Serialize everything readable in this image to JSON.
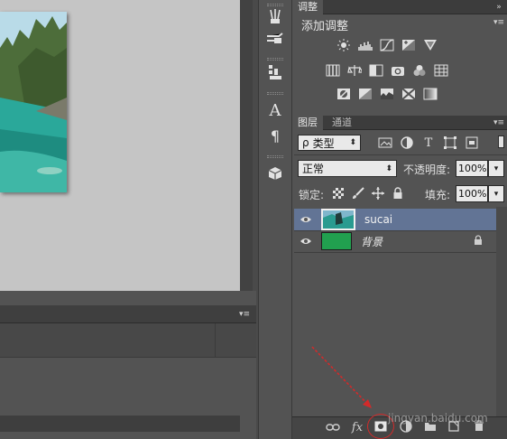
{
  "colors": {
    "panel": "#535353",
    "selected_layer": "#627495",
    "background_swatch": "#21a04f",
    "arrow": "#d22a2a"
  },
  "adjustments": {
    "tab_label": "调整",
    "title": "添加调整",
    "row1": [
      "brightness-icon",
      "levels-icon",
      "curves-icon",
      "exposure-icon",
      "vibrance-icon"
    ],
    "row2": [
      "hue-saturation-icon",
      "color-balance-icon",
      "black-white-icon",
      "photo-filter-icon",
      "channel-mixer-icon",
      "color-lookup-icon"
    ],
    "row3": [
      "invert-icon",
      "posterize-icon",
      "threshold-icon",
      "selective-color-icon",
      "gradient-map-icon"
    ]
  },
  "layers_panel": {
    "tabs": [
      {
        "label": "图层",
        "active": true
      },
      {
        "label": "通道",
        "active": false
      }
    ],
    "filter": {
      "search_glyph": "ρ",
      "value": "类型"
    },
    "blend_mode": "正常",
    "opacity_label": "不透明度:",
    "opacity_value": "100%",
    "lock_label": "锁定:",
    "fill_label": "填充:",
    "fill_value": "100%",
    "layers": [
      {
        "name": "sucai",
        "selected": true,
        "visible": true
      },
      {
        "name": "背景",
        "selected": false,
        "visible": true,
        "locked": true
      }
    ],
    "footer_fx": "fx"
  },
  "toolstrip": {
    "type_glyph": "A",
    "paragraph_glyph": "¶"
  },
  "watermark": "jingyan.baidu.com"
}
